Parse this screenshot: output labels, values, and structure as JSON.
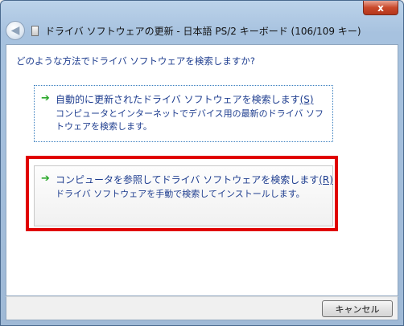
{
  "window": {
    "close_label": "x",
    "title": "ドライバ ソフトウェアの更新 - 日本語 PS/2 キーボード (106/109 キー)"
  },
  "back_button": {
    "glyph": "◀"
  },
  "question": "どのような方法でドライバ ソフトウェアを検索しますか?",
  "options": [
    {
      "arrow": "➔",
      "title": "自動的に更新されたドライバ ソフトウェアを検索します",
      "accel": "(S)",
      "description": "コンピュータとインターネットでデバイス用の最新のドライバ ソフトウェアを検索します。"
    },
    {
      "arrow": "➔",
      "title": "コンピュータを参照してドライバ ソフトウェアを検索します",
      "accel": "(R)",
      "description": "ドライバ ソフトウェアを手動で検索してインストールします。"
    }
  ],
  "footer": {
    "cancel_label": "キャンセル"
  },
  "colors": {
    "link_text": "#1e3d8f",
    "arrow_green": "#2aa82a",
    "highlight_red": "#e00000",
    "close_red": "#c9492b"
  },
  "icons": {
    "close": "close-icon",
    "back": "back-arrow-icon",
    "device": "device-icon",
    "option_arrow": "green-arrow-icon"
  }
}
